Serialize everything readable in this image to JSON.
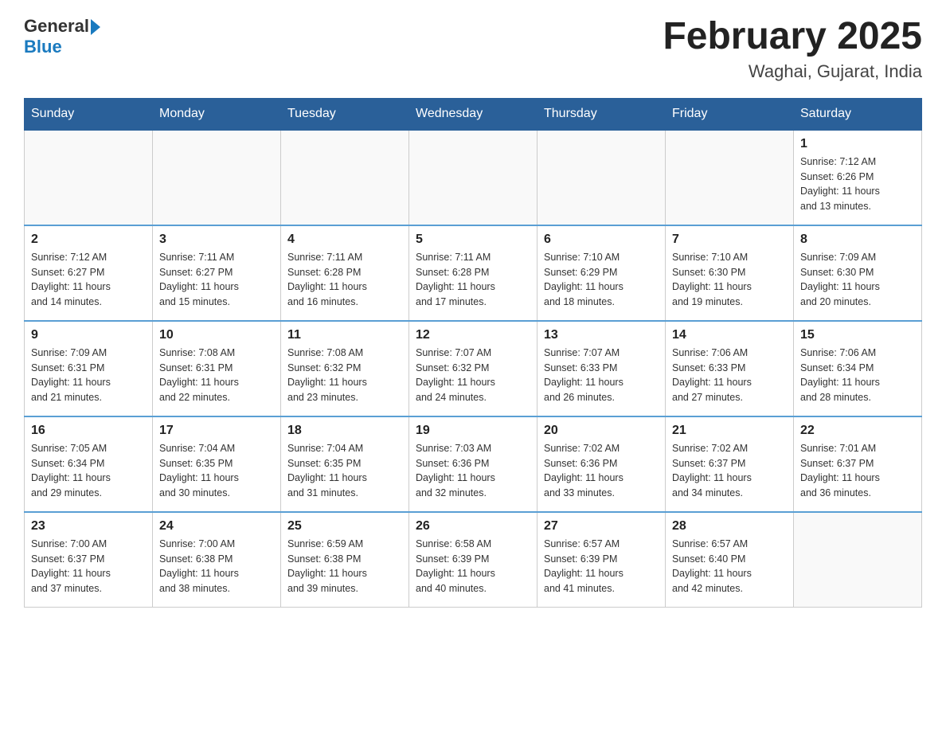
{
  "header": {
    "logo_general": "General",
    "logo_blue": "Blue",
    "month_title": "February 2025",
    "location": "Waghai, Gujarat, India"
  },
  "days_of_week": [
    "Sunday",
    "Monday",
    "Tuesday",
    "Wednesday",
    "Thursday",
    "Friday",
    "Saturday"
  ],
  "weeks": [
    [
      {
        "day": "",
        "info": ""
      },
      {
        "day": "",
        "info": ""
      },
      {
        "day": "",
        "info": ""
      },
      {
        "day": "",
        "info": ""
      },
      {
        "day": "",
        "info": ""
      },
      {
        "day": "",
        "info": ""
      },
      {
        "day": "1",
        "info": "Sunrise: 7:12 AM\nSunset: 6:26 PM\nDaylight: 11 hours\nand 13 minutes."
      }
    ],
    [
      {
        "day": "2",
        "info": "Sunrise: 7:12 AM\nSunset: 6:27 PM\nDaylight: 11 hours\nand 14 minutes."
      },
      {
        "day": "3",
        "info": "Sunrise: 7:11 AM\nSunset: 6:27 PM\nDaylight: 11 hours\nand 15 minutes."
      },
      {
        "day": "4",
        "info": "Sunrise: 7:11 AM\nSunset: 6:28 PM\nDaylight: 11 hours\nand 16 minutes."
      },
      {
        "day": "5",
        "info": "Sunrise: 7:11 AM\nSunset: 6:28 PM\nDaylight: 11 hours\nand 17 minutes."
      },
      {
        "day": "6",
        "info": "Sunrise: 7:10 AM\nSunset: 6:29 PM\nDaylight: 11 hours\nand 18 minutes."
      },
      {
        "day": "7",
        "info": "Sunrise: 7:10 AM\nSunset: 6:30 PM\nDaylight: 11 hours\nand 19 minutes."
      },
      {
        "day": "8",
        "info": "Sunrise: 7:09 AM\nSunset: 6:30 PM\nDaylight: 11 hours\nand 20 minutes."
      }
    ],
    [
      {
        "day": "9",
        "info": "Sunrise: 7:09 AM\nSunset: 6:31 PM\nDaylight: 11 hours\nand 21 minutes."
      },
      {
        "day": "10",
        "info": "Sunrise: 7:08 AM\nSunset: 6:31 PM\nDaylight: 11 hours\nand 22 minutes."
      },
      {
        "day": "11",
        "info": "Sunrise: 7:08 AM\nSunset: 6:32 PM\nDaylight: 11 hours\nand 23 minutes."
      },
      {
        "day": "12",
        "info": "Sunrise: 7:07 AM\nSunset: 6:32 PM\nDaylight: 11 hours\nand 24 minutes."
      },
      {
        "day": "13",
        "info": "Sunrise: 7:07 AM\nSunset: 6:33 PM\nDaylight: 11 hours\nand 26 minutes."
      },
      {
        "day": "14",
        "info": "Sunrise: 7:06 AM\nSunset: 6:33 PM\nDaylight: 11 hours\nand 27 minutes."
      },
      {
        "day": "15",
        "info": "Sunrise: 7:06 AM\nSunset: 6:34 PM\nDaylight: 11 hours\nand 28 minutes."
      }
    ],
    [
      {
        "day": "16",
        "info": "Sunrise: 7:05 AM\nSunset: 6:34 PM\nDaylight: 11 hours\nand 29 minutes."
      },
      {
        "day": "17",
        "info": "Sunrise: 7:04 AM\nSunset: 6:35 PM\nDaylight: 11 hours\nand 30 minutes."
      },
      {
        "day": "18",
        "info": "Sunrise: 7:04 AM\nSunset: 6:35 PM\nDaylight: 11 hours\nand 31 minutes."
      },
      {
        "day": "19",
        "info": "Sunrise: 7:03 AM\nSunset: 6:36 PM\nDaylight: 11 hours\nand 32 minutes."
      },
      {
        "day": "20",
        "info": "Sunrise: 7:02 AM\nSunset: 6:36 PM\nDaylight: 11 hours\nand 33 minutes."
      },
      {
        "day": "21",
        "info": "Sunrise: 7:02 AM\nSunset: 6:37 PM\nDaylight: 11 hours\nand 34 minutes."
      },
      {
        "day": "22",
        "info": "Sunrise: 7:01 AM\nSunset: 6:37 PM\nDaylight: 11 hours\nand 36 minutes."
      }
    ],
    [
      {
        "day": "23",
        "info": "Sunrise: 7:00 AM\nSunset: 6:37 PM\nDaylight: 11 hours\nand 37 minutes."
      },
      {
        "day": "24",
        "info": "Sunrise: 7:00 AM\nSunset: 6:38 PM\nDaylight: 11 hours\nand 38 minutes."
      },
      {
        "day": "25",
        "info": "Sunrise: 6:59 AM\nSunset: 6:38 PM\nDaylight: 11 hours\nand 39 minutes."
      },
      {
        "day": "26",
        "info": "Sunrise: 6:58 AM\nSunset: 6:39 PM\nDaylight: 11 hours\nand 40 minutes."
      },
      {
        "day": "27",
        "info": "Sunrise: 6:57 AM\nSunset: 6:39 PM\nDaylight: 11 hours\nand 41 minutes."
      },
      {
        "day": "28",
        "info": "Sunrise: 6:57 AM\nSunset: 6:40 PM\nDaylight: 11 hours\nand 42 minutes."
      },
      {
        "day": "",
        "info": ""
      }
    ]
  ]
}
